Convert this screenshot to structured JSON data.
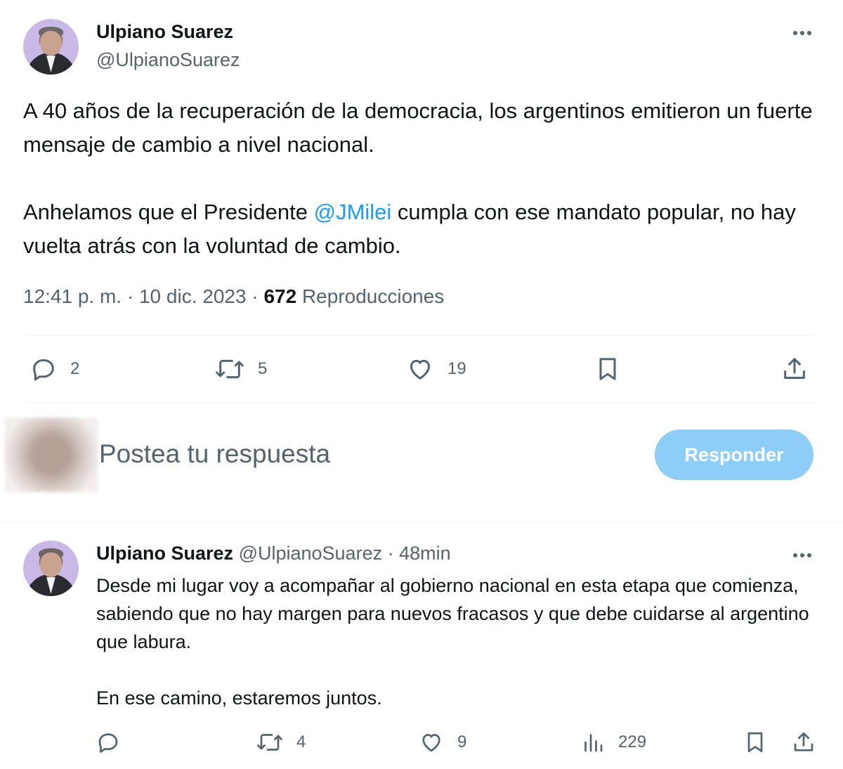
{
  "main_tweet": {
    "author_name": "Ulpiano Suarez",
    "author_handle": "@UlpianoSuarez",
    "more_icon": "more-horizontal-icon",
    "text_p1": "A 40 años de la recuperación de la democracia, los argentinos emitieron un fuerte mensaje de cambio a nivel nacional.",
    "text_p2_before": "Anhelamos que el Presidente ",
    "text_p2_mention": "@JMilei",
    "text_p2_after": " cumpla con ese mandato popular, no hay vuelta atrás con la voluntad de cambio.",
    "time": "12:41 p. m.",
    "sep1": "·",
    "date": "10 dic. 2023",
    "sep2": "·",
    "views_count": "672",
    "views_label": "Reproducciones",
    "actions": {
      "reply_count": "2",
      "retweet_count": "5",
      "like_count": "19"
    },
    "mention_color": "#1d9bf0"
  },
  "reply_composer": {
    "placeholder": "Postea tu respuesta",
    "button_label": "Responder",
    "button_color": "#8ecdf8"
  },
  "reply_tweet": {
    "author_name": "Ulpiano Suarez",
    "author_handle": "@UlpianoSuarez",
    "sep": "·",
    "time_ago": "48min",
    "text_p1": "Desde mi lugar voy a acompañar al gobierno nacional en esta etapa que comienza, sabiendo que no hay margen para nuevos fracasos y que debe cuidarse al argentino que labura.",
    "text_p2": "En ese camino, estaremos juntos.",
    "actions": {
      "reply_count": "",
      "retweet_count": "4",
      "like_count": "9",
      "views_count": "229"
    }
  }
}
